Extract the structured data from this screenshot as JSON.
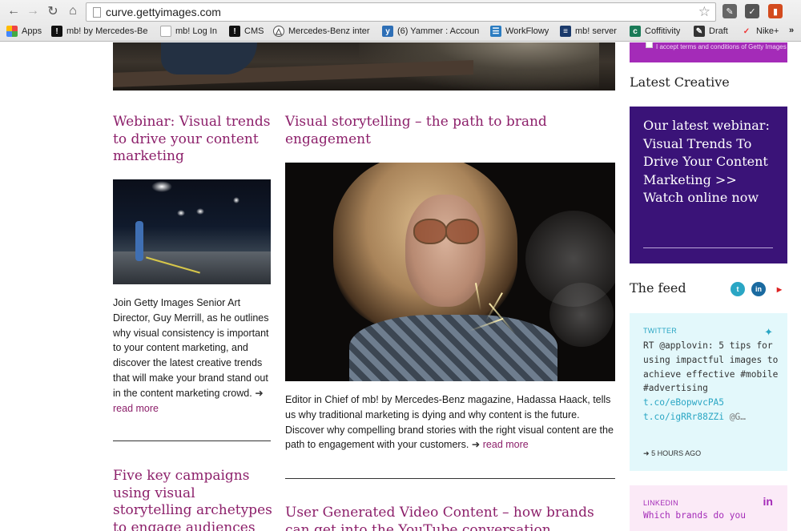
{
  "browser": {
    "url": "curve.gettyimages.com",
    "bookmarks": [
      {
        "label": "Apps",
        "icon": "apps-grid-icon"
      },
      {
        "label": "mb! by Mercedes-Be",
        "icon": "mb-exclamation-icon"
      },
      {
        "label": "mb! Log In",
        "icon": "page-icon"
      },
      {
        "label": "CMS",
        "icon": "mb-exclamation-icon"
      },
      {
        "label": "Mercedes-Benz inter",
        "icon": "mercedes-star-icon"
      },
      {
        "label": "(6) Yammer : Accoun",
        "icon": "yammer-icon"
      },
      {
        "label": "WorkFlowy",
        "icon": "workflowy-icon"
      },
      {
        "label": "mb! server",
        "icon": "server-icon"
      },
      {
        "label": "Coffitivity",
        "icon": "coffitivity-icon"
      },
      {
        "label": "Draft",
        "icon": "draft-icon"
      },
      {
        "label": "Nike+",
        "icon": "nike-icon"
      }
    ]
  },
  "articles": {
    "left": {
      "title": "Webinar: Visual trends to drive your content marketing",
      "body": "Join Getty Images Senior Art Director, Guy Merrill, as he outlines why visual consistency is important to your content marketing, and discover the latest creative trends that will make your brand stand out in the content marketing crowd.",
      "read_more": "read more"
    },
    "center": {
      "title": "Visual storytelling – the path to brand engagement",
      "body": "Editor in Chief of mb! by Mercedes-Benz magazine, Hadassa Haack, tells us why traditional marketing is dying and why content is the future. Discover why compelling brand stories with the right visual content are the path to engagement with your customers.",
      "read_more": "read more"
    },
    "left_next": {
      "title": "Five key campaigns using visual storytelling archetypes to engage audiences"
    },
    "center_next": {
      "title": "User Generated Video Content – how brands can get into the YouTube conversation"
    }
  },
  "sidebar": {
    "terms_text": "I accept terms and conditions of Getty Images",
    "latest_creative": "Latest Creative",
    "promo": "Our latest webinar: Visual Trends To Drive Your Content Marketing >> Watch online now",
    "feed_heading": "The feed",
    "twitter": {
      "label": "TWITTER",
      "text": "RT @applovin: 5 tips for using impactful images to achieve effective #mobile #advertising",
      "link1": "t.co/eBopwvcPA5",
      "link2": "t.co/igRRr88ZZi",
      "tail": "@G…",
      "ago": "5 HOURS AGO"
    },
    "linkedin": {
      "label": "LINKEDIN",
      "text": "Which brands do you"
    }
  },
  "colors": {
    "accent": "#8c1f6a",
    "promo_bg": "#3a1378",
    "twitter_card": "#e3f8fb",
    "linkedin_card": "#fbeaf7"
  }
}
